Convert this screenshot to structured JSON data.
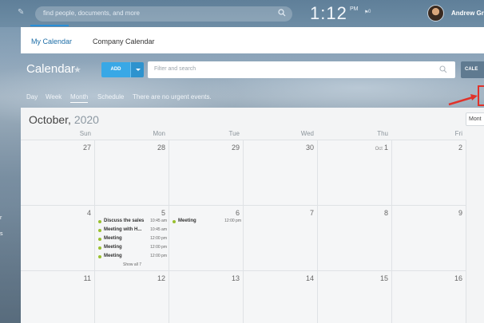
{
  "topbar": {
    "search_placeholder": "find people, documents, and more",
    "clock": "1:12",
    "ampm": "PM",
    "bell_count": "0",
    "user_name": "Andrew Gri"
  },
  "tabs": [
    {
      "label": "My Calendar",
      "active": true
    },
    {
      "label": "Company Calendar",
      "active": false
    }
  ],
  "toolbar": {
    "title": "Calendar",
    "add_label": "ADD",
    "filter_placeholder": "Filter and search",
    "calendars_label": "CALE"
  },
  "views": {
    "items": [
      "Day",
      "Week",
      "Month",
      "Schedule"
    ],
    "active": "Month",
    "notice": "There are no urgent events."
  },
  "calendar": {
    "month": "October,",
    "year": "2020",
    "view_select": "Mont",
    "weekdays": [
      "Sun",
      "Mon",
      "Tue",
      "Wed",
      "Thu",
      "Fri"
    ],
    "weeks": [
      [
        {
          "day": "27"
        },
        {
          "day": "28"
        },
        {
          "day": "29"
        },
        {
          "day": "30"
        },
        {
          "day": "1",
          "month_prefix": "Oct"
        },
        {
          "day": "2"
        }
      ],
      [
        {
          "day": "4"
        },
        {
          "day": "5",
          "events": [
            {
              "title": "Discuss the sales",
              "time": "10:45 am"
            },
            {
              "title": "Meeting with H...",
              "time": "10:45 am"
            },
            {
              "title": "Meeting",
              "time": "12:00 pm"
            },
            {
              "title": "Meeting",
              "time": "12:00 pm"
            },
            {
              "title": "Meeting",
              "time": "12:00 pm"
            }
          ],
          "show_all": "Show all 7"
        },
        {
          "day": "6",
          "events": [
            {
              "title": "Meeting",
              "time": "12:00 pm"
            }
          ]
        },
        {
          "day": "7"
        },
        {
          "day": "8"
        },
        {
          "day": "9"
        }
      ],
      [
        {
          "day": "11"
        },
        {
          "day": "12"
        },
        {
          "day": "13"
        },
        {
          "day": "14"
        },
        {
          "day": "15"
        },
        {
          "day": "16"
        }
      ]
    ]
  },
  "colors": {
    "accent": "#39a8e6",
    "event_dot": "#9ac02f",
    "highlight": "#e0322a"
  }
}
